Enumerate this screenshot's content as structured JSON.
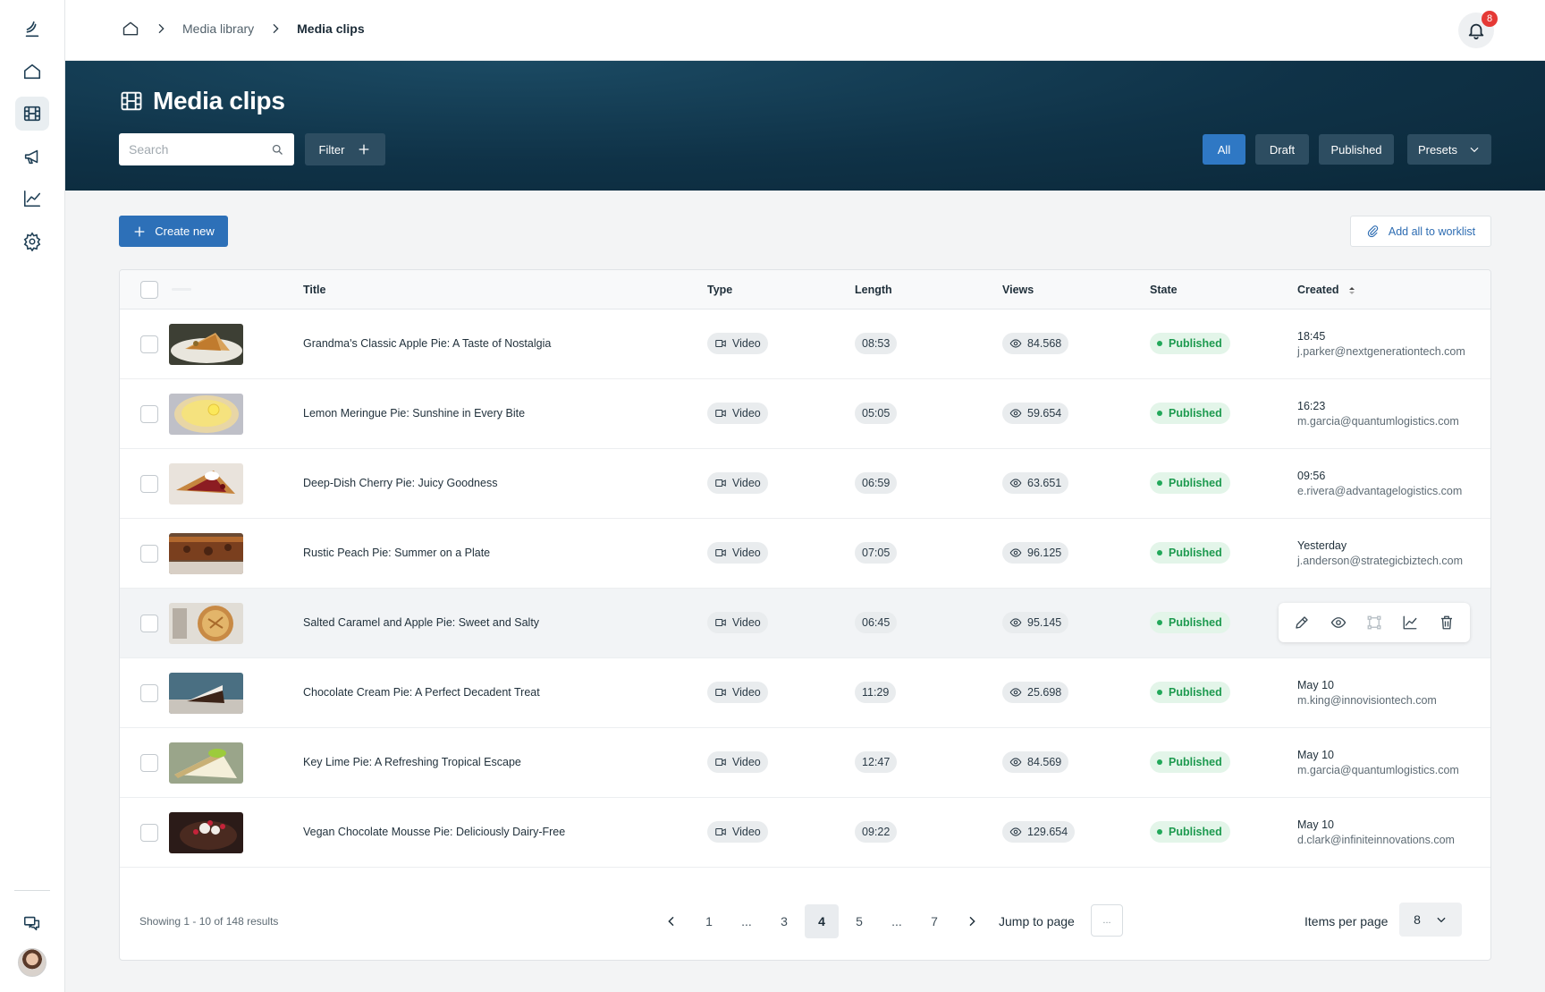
{
  "breadcrumb": {
    "home_icon": "home-icon",
    "items": [
      "Media library",
      "Media clips"
    ]
  },
  "notifications": {
    "count": "8"
  },
  "page": {
    "title": "Media clips"
  },
  "search": {
    "placeholder": "Search",
    "value": ""
  },
  "filter": {
    "label": "Filter"
  },
  "segments": {
    "all": "All",
    "draft": "Draft",
    "published": "Published",
    "presets": "Presets",
    "active": "All"
  },
  "actions": {
    "create_new": "Create new",
    "add_to_worklist": "Add all to worklist"
  },
  "table": {
    "columns": {
      "title": "Title",
      "type": "Type",
      "length": "Length",
      "views": "Views",
      "state": "State",
      "created": "Created"
    },
    "sorted_by": "Created",
    "rows": [
      {
        "title": "Grandma's Classic Apple Pie: A Taste of Nostalgia",
        "type": "Video",
        "length": "08:53",
        "views": "84.568",
        "state": "Published",
        "created": "18:45",
        "email": "j.parker@nextgenerationtech.com"
      },
      {
        "title": "Lemon Meringue Pie: Sunshine in Every Bite",
        "type": "Video",
        "length": "05:05",
        "views": "59.654",
        "state": "Published",
        "created": "16:23",
        "email": "m.garcia@quantumlogistics.com"
      },
      {
        "title": "Deep-Dish  Cherry Pie: Juicy Goodness",
        "type": "Video",
        "length": "06:59",
        "views": "63.651",
        "state": "Published",
        "created": "09:56",
        "email": "e.rivera@advantagelogistics.com"
      },
      {
        "title": "Rustic Peach Pie: Summer on a Plate",
        "type": "Video",
        "length": "07:05",
        "views": "96.125",
        "state": "Published",
        "created": "Yesterday",
        "email": "j.anderson@strategicbiztech.com"
      },
      {
        "title": "Salted Caramel and Apple Pie: Sweet and Salty",
        "type": "Video",
        "length": "06:45",
        "views": "95.145",
        "state": "Published",
        "created": "",
        "email": ""
      },
      {
        "title": "Chocolate Cream Pie: A Perfect Decadent Treat",
        "type": "Video",
        "length": "11:29",
        "views": "25.698",
        "state": "Published",
        "created": "May 10",
        "email": "m.king@innovisiontech.com"
      },
      {
        "title": "Key Lime Pie: A Refreshing Tropical Escape",
        "type": "Video",
        "length": "12:47",
        "views": "84.569",
        "state": "Published",
        "created": "May 10",
        "email": "m.garcia@quantumlogistics.com"
      },
      {
        "title": "Vegan Chocolate Mousse Pie: Deliciously Dairy-Free",
        "type": "Video",
        "length": "09:22",
        "views": "129.654",
        "state": "Published",
        "created": "May 10",
        "email": "d.clark@infiniteinnovations.com"
      }
    ],
    "hovered_row_actions": [
      "edit-icon",
      "preview-icon",
      "crop-icon",
      "analytics-icon",
      "delete-icon"
    ]
  },
  "pagination": {
    "showing": "Showing 1 - 10 of 148 results",
    "pages": [
      "1",
      "...",
      "3",
      "4",
      "5",
      "...",
      "7"
    ],
    "current": "4",
    "jump_label": "Jump to page",
    "jump_placeholder": "...",
    "items_per_page_label": "Items per page",
    "items_per_page": "8"
  },
  "colors": {
    "hero": "#0f3247",
    "accent": "#2f78c4",
    "published": "#1d9a4f"
  }
}
